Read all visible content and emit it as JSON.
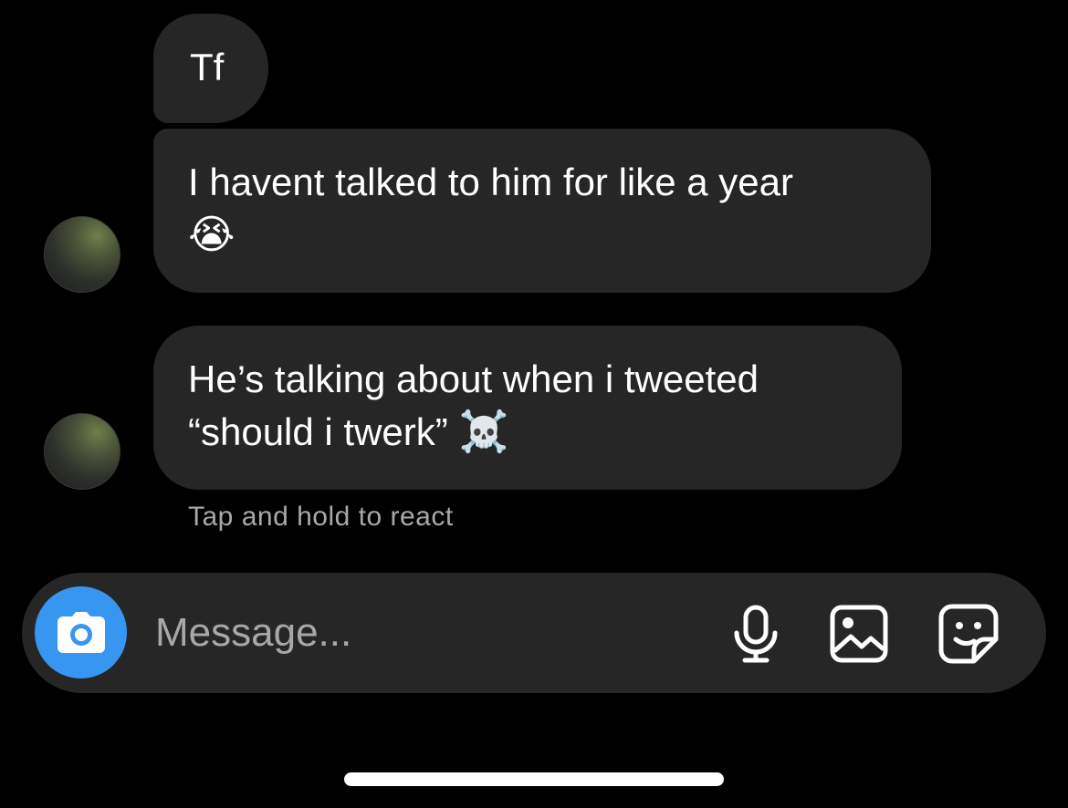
{
  "messages": [
    {
      "lines": [
        "Tf"
      ]
    },
    {
      "lines": [
        "I havent talked to him for like a year"
      ],
      "emoji": "😭"
    },
    {
      "lines": [
        "He’s talking about when i tweeted"
      ],
      "line2_text": "“should i twerk”",
      "emoji": "☠️"
    }
  ],
  "hint": "Tap and hold to react",
  "composer": {
    "placeholder": "Message...",
    "icons": [
      "camera-icon",
      "microphone-icon",
      "gallery-icon",
      "sticker-icon"
    ]
  },
  "colors": {
    "background": "#000000",
    "bubble": "#262626",
    "accent": "#3797f0",
    "secondary_text": "#a8a8a8"
  }
}
